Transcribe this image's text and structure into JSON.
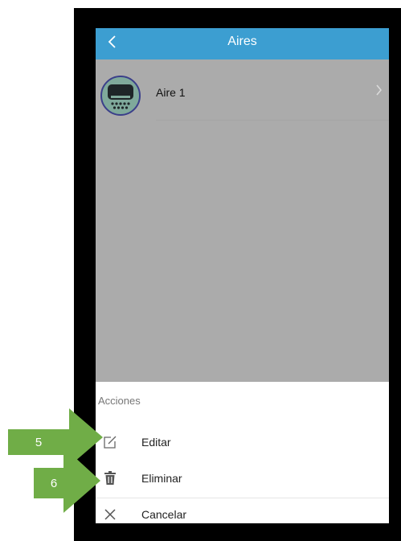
{
  "header": {
    "title": "Aires",
    "back_icon": "chevron-left-icon",
    "color": "#3c9ed1"
  },
  "list": {
    "items": [
      {
        "label": "Aire 1",
        "icon": "air-conditioner-icon",
        "chevron": "chevron-right-icon"
      }
    ]
  },
  "action_sheet": {
    "title": "Acciones",
    "actions": [
      {
        "label": "Editar",
        "icon": "edit-icon"
      },
      {
        "label": "Eliminar",
        "icon": "trash-icon"
      },
      {
        "label": "Cancelar",
        "icon": "close-icon"
      }
    ]
  },
  "callouts": [
    {
      "number": "5"
    },
    {
      "number": "6"
    }
  ],
  "colors": {
    "overlay": "#ababab",
    "callout_green": "#70ad47",
    "frame": "#000000"
  }
}
